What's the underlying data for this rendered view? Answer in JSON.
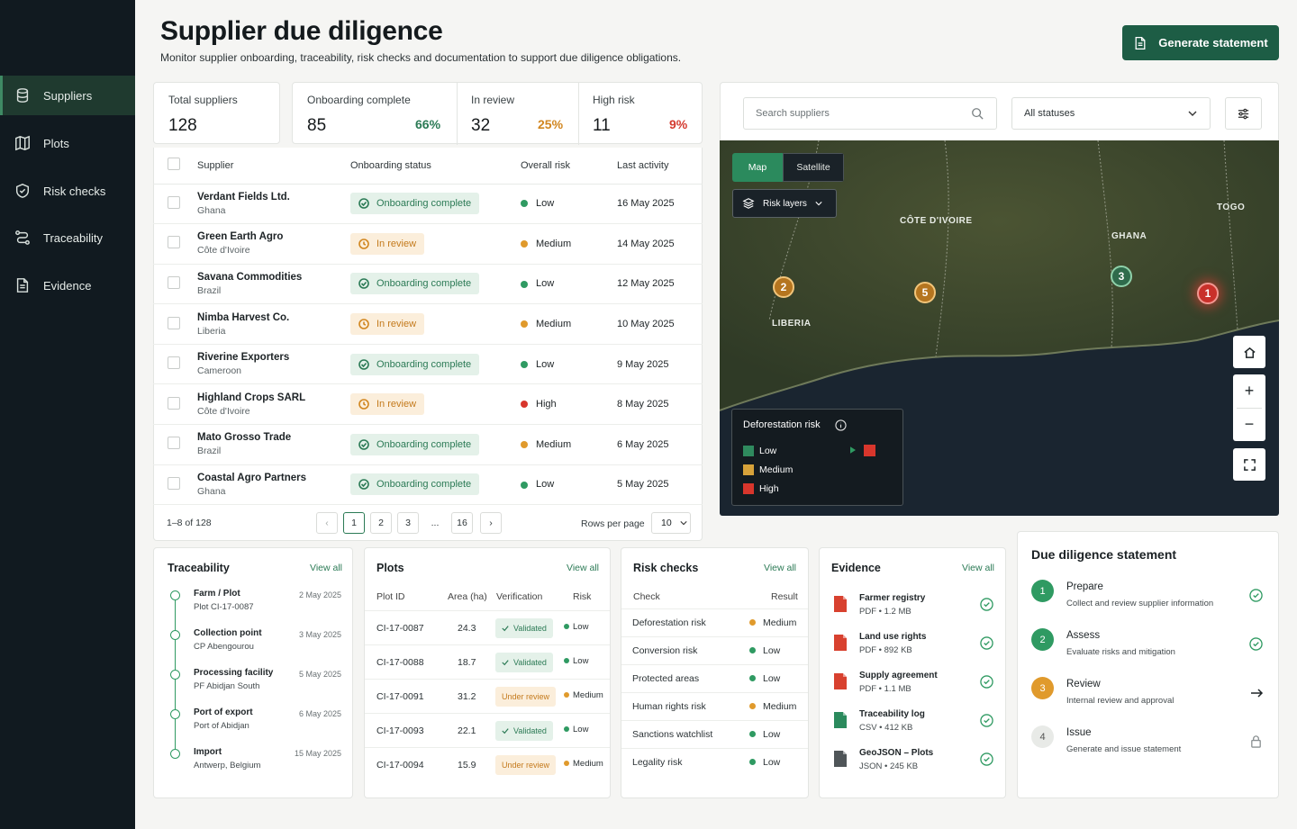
{
  "sidebar": {
    "items": [
      {
        "label": "Suppliers",
        "icon": "database-icon",
        "active": true
      },
      {
        "label": "Plots",
        "icon": "map-icon"
      },
      {
        "label": "Risk checks",
        "icon": "shield-icon"
      },
      {
        "label": "Traceability",
        "icon": "route-icon"
      },
      {
        "label": "Evidence",
        "icon": "document-icon"
      }
    ]
  },
  "header": {
    "title": "Supplier due diligence",
    "subtitle": "Monitor supplier onboarding, traceability, risk checks and documentation to support due diligence obligations.",
    "generate_label": "Generate statement"
  },
  "kpis": [
    {
      "label": "Total suppliers",
      "value": "128",
      "pct": ""
    },
    {
      "label": "Onboarding complete",
      "value": "85",
      "pct": "66%",
      "color": "#2b7a55"
    },
    {
      "label": "In review",
      "value": "32",
      "pct": "25%",
      "color": "#d1861f"
    },
    {
      "label": "High risk",
      "value": "11",
      "pct": "9%",
      "color": "#d43a2f"
    }
  ],
  "supplier_table": {
    "headers": [
      "Supplier",
      "Onboarding status",
      "Overall risk",
      "Last activity"
    ],
    "rows": [
      {
        "name": "Verdant Fields Ltd.",
        "country": "Ghana",
        "status": "Onboarding complete",
        "risk": "Low",
        "date": "16 May 2025"
      },
      {
        "name": "Green Earth Agro",
        "country": "Côte d'Ivoire",
        "status": "In review",
        "risk": "Medium",
        "date": "14 May 2025"
      },
      {
        "name": "Savana Commodities",
        "country": "Brazil",
        "status": "Onboarding complete",
        "risk": "Low",
        "date": "12 May 2025"
      },
      {
        "name": "Nimba Harvest Co.",
        "country": "Liberia",
        "status": "In review",
        "risk": "Medium",
        "date": "10 May 2025"
      },
      {
        "name": "Riverine Exporters",
        "country": "Cameroon",
        "status": "Onboarding complete",
        "risk": "Low",
        "date": "9 May 2025"
      },
      {
        "name": "Highland Crops SARL",
        "country": "Côte d'Ivoire",
        "status": "In review",
        "risk": "High",
        "date": "8 May 2025"
      },
      {
        "name": "Mato Grosso Trade",
        "country": "Brazil",
        "status": "Onboarding complete",
        "risk": "Medium",
        "date": "6 May 2025"
      },
      {
        "name": "Coastal Agro Partners",
        "country": "Ghana",
        "status": "Onboarding complete",
        "risk": "Low",
        "date": "5 May 2025"
      }
    ],
    "range_text": "1–8 of 128",
    "pages": [
      "1",
      "2",
      "3",
      "...",
      "16"
    ],
    "current_page": "1",
    "rows_per_page_label": "Rows per page",
    "rows_per_page": "10"
  },
  "map_panel": {
    "search_placeholder": "Search suppliers",
    "status_filter": "All statuses",
    "tabs": [
      "Map",
      "Satellite"
    ],
    "active_tab": "Map",
    "risk_layers_label": "Risk layers",
    "country_labels": [
      "CÔTE D'IVOIRE",
      "GHANA",
      "TOGO",
      "LIBERIA"
    ],
    "markers": [
      {
        "count": "2",
        "level": "Medium"
      },
      {
        "count": "5",
        "level": "Medium"
      },
      {
        "count": "3",
        "level": "Low"
      },
      {
        "count": "1",
        "level": "High"
      }
    ],
    "legend": {
      "title": "Deforestation risk",
      "items": [
        {
          "label": "Low",
          "color": "#2f8a5e"
        },
        {
          "label": "Medium",
          "color": "#d7a23a"
        },
        {
          "label": "High",
          "color": "#d8362c"
        }
      ]
    }
  },
  "traceability": {
    "title": "Traceability",
    "view_all": "View all",
    "steps": [
      {
        "title": "Farm / Plot",
        "sub": "Plot CI-17-0087",
        "date": "2 May 2025"
      },
      {
        "title": "Collection point",
        "sub": "CP Abengourou",
        "date": "3 May 2025"
      },
      {
        "title": "Processing facility",
        "sub": "PF Abidjan South",
        "date": "5 May 2025"
      },
      {
        "title": "Port of export",
        "sub": "Port of Abidjan",
        "date": "6 May 2025"
      },
      {
        "title": "Import",
        "sub": "Antwerp, Belgium",
        "date": "15 May 2025"
      }
    ]
  },
  "plots": {
    "title": "Plots",
    "view_all": "View all",
    "headers": [
      "Plot ID",
      "Area (ha)",
      "Verification",
      "Risk"
    ],
    "rows": [
      {
        "id": "CI-17-0087",
        "area": "24.3",
        "verification": "Validated",
        "risk": "Low"
      },
      {
        "id": "CI-17-0088",
        "area": "18.7",
        "verification": "Validated",
        "risk": "Low"
      },
      {
        "id": "CI-17-0091",
        "area": "31.2",
        "verification": "Under review",
        "risk": "Medium"
      },
      {
        "id": "CI-17-0093",
        "area": "22.1",
        "verification": "Validated",
        "risk": "Low"
      },
      {
        "id": "CI-17-0094",
        "area": "15.9",
        "verification": "Under review",
        "risk": "Medium"
      }
    ]
  },
  "risk_checks": {
    "title": "Risk checks",
    "view_all": "View all",
    "headers": [
      "Check",
      "Result"
    ],
    "rows": [
      {
        "check": "Deforestation risk",
        "result": "Medium"
      },
      {
        "check": "Conversion risk",
        "result": "Low"
      },
      {
        "check": "Protected areas",
        "result": "Low"
      },
      {
        "check": "Human rights risk",
        "result": "Medium"
      },
      {
        "check": "Sanctions watchlist",
        "result": "Low"
      },
      {
        "check": "Legality risk",
        "result": "Low"
      }
    ]
  },
  "evidence": {
    "title": "Evidence",
    "view_all": "View all",
    "items": [
      {
        "name": "Farmer registry",
        "type": "PDF",
        "size": "1.2 MB",
        "icon": "pdf-icon"
      },
      {
        "name": "Land use rights",
        "type": "PDF",
        "size": "892 KB",
        "icon": "pdf-icon"
      },
      {
        "name": "Supply agreement",
        "type": "PDF",
        "size": "1.1 MB",
        "icon": "pdf-icon"
      },
      {
        "name": "Traceability log",
        "type": "CSV",
        "size": "412 KB",
        "icon": "csv-icon"
      },
      {
        "name": "GeoJSON – Plots",
        "type": "JSON",
        "size": "245 KB",
        "icon": "json-icon"
      }
    ]
  },
  "statement": {
    "title": "Due diligence statement",
    "steps": [
      {
        "num": "1",
        "title": "Prepare",
        "sub": "Collect and review supplier information",
        "state": "done"
      },
      {
        "num": "2",
        "title": "Assess",
        "sub": "Evaluate risks and mitigation",
        "state": "done"
      },
      {
        "num": "3",
        "title": "Review",
        "sub": "Internal review and approval",
        "state": "current"
      },
      {
        "num": "4",
        "title": "Issue",
        "sub": "Generate and issue statement",
        "state": "locked"
      }
    ]
  },
  "colors": {
    "primary": "#1d5d45",
    "low": "#2f9a62",
    "medium": "#e09a2c",
    "high": "#d8362c"
  }
}
